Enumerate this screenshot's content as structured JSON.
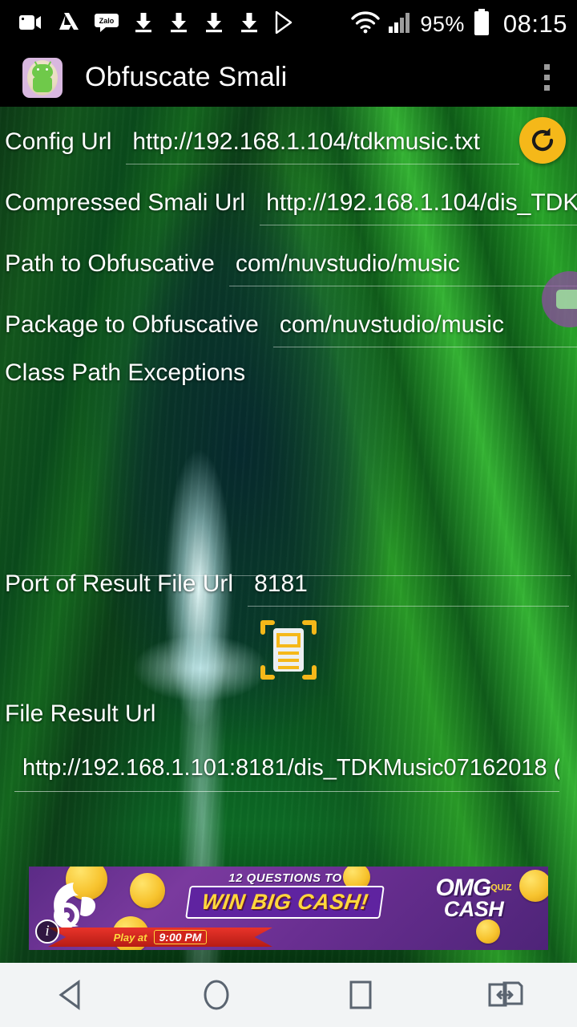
{
  "status_bar": {
    "icons": [
      "video-camera-icon",
      "google-drive-icon",
      "zalo-icon",
      "download-icon",
      "download-icon",
      "download-icon",
      "download-icon",
      "play-store-icon"
    ],
    "wifi_icon": "wifi-icon",
    "signal_icon": "cellular-signal-icon",
    "battery_percent": "95%",
    "battery_icon": "battery-icon",
    "clock": "08:15"
  },
  "app_bar": {
    "icon_name": "app-logo-icon",
    "title": "Obfuscate Smali",
    "overflow_icon": "overflow-menu-icon"
  },
  "form": {
    "fields": [
      {
        "label": "Config Url",
        "value": "http://192.168.1.104/tdkmusic.txt",
        "placeholder": "Config Url"
      },
      {
        "label": "Compressed Smali Url",
        "value": "http://192.168.1.104/dis_TDK",
        "placeholder": "Compressed Smali Url"
      },
      {
        "label": "Path to Obfuscative",
        "value": "com/nuvstudio/music",
        "placeholder": "Path to Obfuscative"
      },
      {
        "label": "Package to Obfuscative",
        "value": "com/nuvstudio/music",
        "placeholder": "Package to Obfuscative"
      },
      {
        "label": "Class Path Exceptions",
        "value": "",
        "placeholder": "Class Path Exceptions"
      },
      {
        "label": "Port of Result File Url",
        "value": "8181",
        "placeholder": "Port of Result File Url"
      }
    ],
    "result": {
      "label": "File Result Url",
      "value": "http://192.168.1.101:8181/dis_TDKMusic07162018 ("
    },
    "scan_button_icon": "document-scan-icon",
    "refresh_button_icon": "refresh-icon"
  },
  "floating_bubble": {
    "icon": "screen-recorder-icon"
  },
  "ad": {
    "line1": "12 QUESTIONS TO",
    "line2": "WIN BIG CASH!",
    "play_at": "Play at",
    "time": "9:00 PM",
    "logo_main": "OMG",
    "logo_quiz": "QUIZ",
    "logo_omg_small": "OMG",
    "logo_cash": "CASH",
    "info_label": "i",
    "mascot_icon": "uc-browser-squirrel-icon"
  },
  "nav_bar": {
    "back": "back-nav-icon",
    "home": "home-nav-icon",
    "recents": "recents-nav-icon",
    "switch": "app-switch-nav-icon"
  },
  "colors": {
    "accent_orange": "#f5b819",
    "status_bar_bg": "#000000",
    "nav_bar_bg": "#f2f4f5",
    "ad_purple": "#5b2b86"
  }
}
